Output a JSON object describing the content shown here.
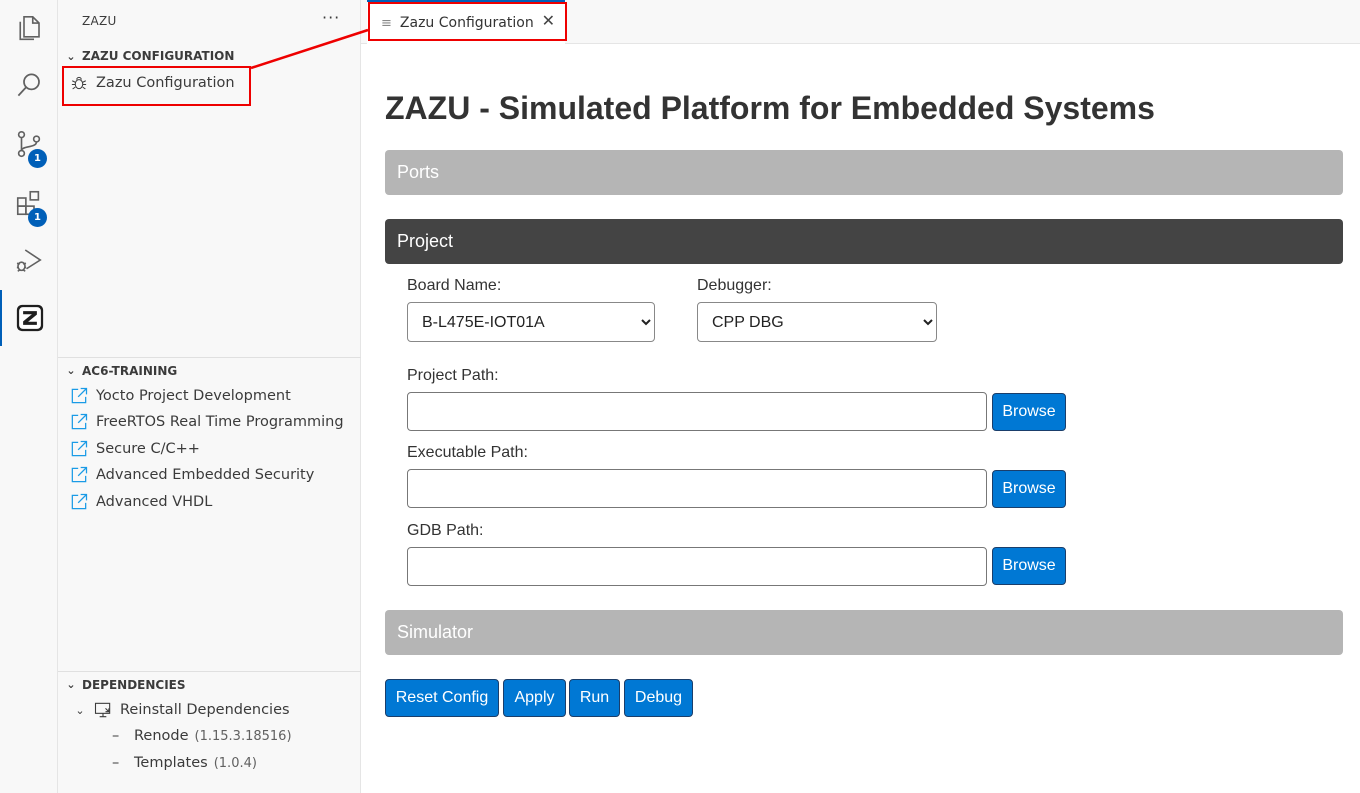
{
  "sidebar": {
    "title": "ZAZU",
    "more": "···",
    "sections": {
      "zazu_config": {
        "title": "ZAZU CONFIGURATION",
        "items": [
          {
            "label": "Zazu Configuration",
            "icon": "bug-icon"
          }
        ]
      },
      "training": {
        "title": "AC6-TRAINING",
        "items": [
          {
            "label": "Yocto Project Development"
          },
          {
            "label": "FreeRTOS Real Time Programming"
          },
          {
            "label": "Secure C/C++"
          },
          {
            "label": "Advanced Embedded Security"
          },
          {
            "label": "Advanced VHDL"
          }
        ]
      },
      "dependencies": {
        "title": "DEPENDENCIES",
        "reinstall": "Reinstall Dependencies",
        "items": [
          {
            "name": "Renode",
            "version": "(1.15.3.18516)"
          },
          {
            "name": "Templates",
            "version": "(1.0.4)"
          }
        ]
      }
    }
  },
  "activity_bar": {
    "badges": {
      "source_control": "1",
      "extensions": "1"
    }
  },
  "tabs": [
    {
      "label": "Zazu Configuration"
    }
  ],
  "editor": {
    "title": "ZAZU - Simulated Platform for Embedded Systems",
    "panels": {
      "ports": "Ports",
      "project": "Project",
      "simulator": "Simulator"
    },
    "board_name": {
      "label": "Board Name:",
      "value": "B-L475E-IOT01A"
    },
    "debugger": {
      "label": "Debugger:",
      "value": "CPP DBG"
    },
    "project_path": {
      "label": "Project Path:",
      "value": ""
    },
    "executable_path": {
      "label": "Executable Path:",
      "value": ""
    },
    "gdb_path": {
      "label": "GDB Path:",
      "value": ""
    },
    "browse_label": "Browse",
    "actions": {
      "reset": "Reset Config",
      "apply": "Apply",
      "run": "Run",
      "debug": "Debug"
    }
  },
  "colors": {
    "accent": "#005fb8",
    "button": "#0078d4",
    "highlight": "#e00000"
  }
}
